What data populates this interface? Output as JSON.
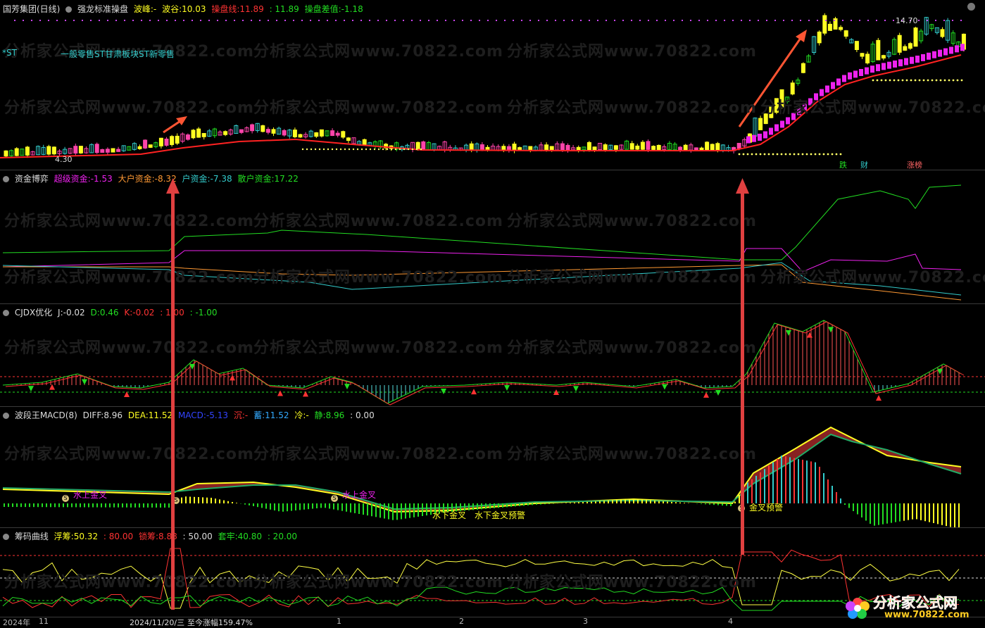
{
  "panel1": {
    "stock": "国芳集团(日线)",
    "indicator": "强龙标准操盘",
    "peak_label": "波峰:",
    "peak_value": "-",
    "trough_label": "波谷:",
    "trough_value": "10.03",
    "line_label": "操盘线:",
    "line_value": "11.89",
    "line_value2": ": 11.89",
    "diff_label": "操盘差值:",
    "diff_value": "-1.18",
    "st_tag": "*ST",
    "sectors": "一般零售ST甘肃板块ST新零售",
    "high_price": "14.70",
    "low_price": "4.30",
    "tag_die": "跌",
    "tag_cai": "财",
    "tag_zhang": "涨榜"
  },
  "panel2": {
    "title": "资金博弈",
    "super_label": "超级资金:",
    "super_value": "-1.53",
    "big_label": "大户资金:",
    "big_value": "-8.32",
    "mid_label": "户资金:",
    "mid_value": "-7.38",
    "retail_label": "散户资金:",
    "retail_value": "17.22"
  },
  "panel3": {
    "title": "CJDX优化",
    "j_label": "J:",
    "j_value": "-0.02",
    "d_label": "D:",
    "d_value": "0.46",
    "k_label": "K:",
    "k_value": "-0.02",
    "v1": ": 1.00",
    "v2": ": -1.00"
  },
  "panel4": {
    "title": "波段王MACD(8)",
    "diff_label": "DIFF:",
    "diff_value": "8.96",
    "dea_label": "DEA:",
    "dea_value": "11.52",
    "macd_label": "MACD:",
    "macd_value": "-5.13",
    "chen_label": "沉:",
    "chen_value": "-",
    "xu_label": "蓄:",
    "xu_value": "11.52",
    "leng_label": "冷:",
    "leng_value": "-",
    "jing_label": "静:",
    "jing_value": "8.96",
    "end_value": ": 0.00",
    "cross1": "水上金叉",
    "cross2": "水上金叉",
    "cross3": "水下金叉",
    "cross4": "水下金叉预警",
    "cross5": "金叉预警",
    "s_badge": "S"
  },
  "panel5": {
    "title": "筹码曲线",
    "float_label": "浮筹:",
    "float_value": "50.32",
    "v80": ": 80.00",
    "lock_label": "锁筹:",
    "lock_value": "8.88",
    "v50": ": 50.00",
    "trap_label": "套牢:",
    "trap_value": "40.80",
    "v20": ": 20.00"
  },
  "xaxis": {
    "year": "2024年",
    "m11": "11",
    "date": "2024/11/20/三",
    "gain": "至今涨幅159.47%",
    "m1": "1",
    "m2": "2",
    "m3": "3",
    "m4": "4"
  },
  "watermark": "分析家公式网www.70822.com",
  "logo": {
    "text": "分析家公式网",
    "url": "www.70822.com"
  },
  "colors": {
    "green": "#22dd22",
    "red": "#ff3333",
    "magenta": "#ee22ee",
    "yellow": "#ffff22",
    "cyan": "#33cccc",
    "orange": "#ff9933"
  }
}
